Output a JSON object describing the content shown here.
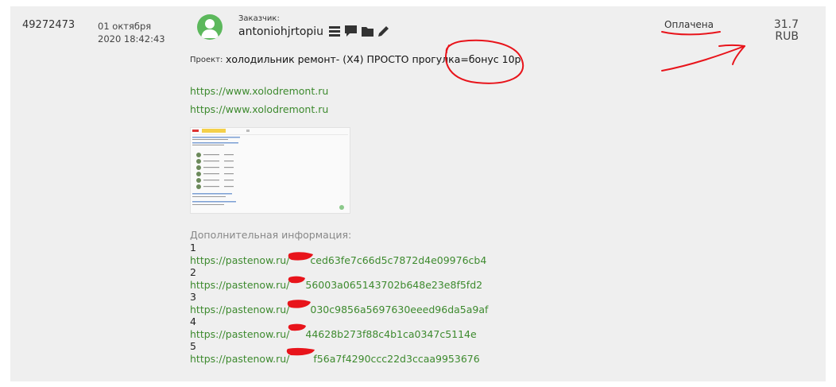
{
  "order": {
    "id": "49272473",
    "date_line1": "01 октября",
    "date_line2": "2020 18:42:43",
    "status": "Оплачена",
    "price_value": "31.7",
    "price_currency": "RUB"
  },
  "customer": {
    "label": "Заказчик:",
    "name": "antoniohjrtopiu"
  },
  "project": {
    "label": "Проект:",
    "title": "холодильник ремонт- (Х4) ПРОСТО прогулка=бонус 10р."
  },
  "links": [
    "https://www.xolodremont.ru",
    "https://www.xolodremont.ru"
  ],
  "additional": {
    "label": "Дополнительная информация:",
    "items": [
      {
        "num": "1",
        "prefix": "https://pastenow.ru/",
        "suffix": "ced63fe7c66d5c7872d4e09976cb4"
      },
      {
        "num": "2",
        "prefix": "https://pastenow.ru/",
        "suffix": "56003a065143702b648e23e8f5fd2"
      },
      {
        "num": "3",
        "prefix": "https://pastenow.ru/",
        "suffix": "030c9856a5697630eeed96da5a9af"
      },
      {
        "num": "4",
        "prefix": "https://pastenow.ru/",
        "suffix": "44628b273f88c4b1ca0347c5114e"
      },
      {
        "num": "5",
        "prefix": "https://pastenow.ru/",
        "suffix": "f56a7f4290ccc22d3ccaa9953676"
      }
    ]
  },
  "icons": [
    "list-icon",
    "comment-icon",
    "folder-icon",
    "pencil-icon",
    "user-avatar-icon"
  ],
  "colors": {
    "link": "#3d8a2e",
    "avatar": "#5cb85c",
    "annotation": "#e8141b",
    "card_bg": "#efefef"
  }
}
